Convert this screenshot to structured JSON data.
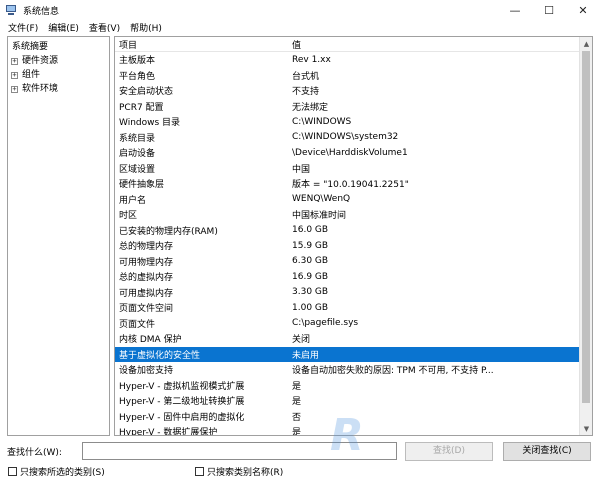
{
  "window": {
    "title": "系统信息",
    "controls": {
      "minimize": "—",
      "maximize": "☐",
      "close": "✕"
    }
  },
  "menu": [
    "文件(F)",
    "编辑(E)",
    "查看(V)",
    "帮助(H)"
  ],
  "tree": {
    "root": "系统摘要",
    "children": [
      "硬件资源",
      "组件",
      "软件环境"
    ],
    "expander": "+"
  },
  "table": {
    "headers": {
      "item": "项目",
      "value": "值"
    },
    "rows": [
      {
        "item": "主板版本",
        "value": "Rev 1.xx"
      },
      {
        "item": "平台角色",
        "value": "台式机"
      },
      {
        "item": "安全启动状态",
        "value": "不支持"
      },
      {
        "item": "PCR7 配置",
        "value": "无法绑定"
      },
      {
        "item": "Windows 目录",
        "value": "C:\\WINDOWS"
      },
      {
        "item": "系统目录",
        "value": "C:\\WINDOWS\\system32"
      },
      {
        "item": "启动设备",
        "value": "\\Device\\HarddiskVolume1"
      },
      {
        "item": "区域设置",
        "value": "中国"
      },
      {
        "item": "硬件抽象层",
        "value": "版本 = \"10.0.19041.2251\""
      },
      {
        "item": "用户名",
        "value": "WENQ\\WenQ"
      },
      {
        "item": "时区",
        "value": "中国标准时间"
      },
      {
        "item": "已安装的物理内存(RAM)",
        "value": "16.0 GB"
      },
      {
        "item": "总的物理内存",
        "value": "15.9 GB"
      },
      {
        "item": "可用物理内存",
        "value": "6.30 GB"
      },
      {
        "item": "总的虚拟内存",
        "value": "16.9 GB"
      },
      {
        "item": "可用虚拟内存",
        "value": "3.30 GB"
      },
      {
        "item": "页面文件空间",
        "value": "1.00 GB"
      },
      {
        "item": "页面文件",
        "value": "C:\\pagefile.sys"
      },
      {
        "item": "内核 DMA 保护",
        "value": "关闭"
      },
      {
        "item": "基于虚拟化的安全性",
        "value": "未启用"
      },
      {
        "item": "设备加密支持",
        "value": "设备自动加密失败的原因: TPM 不可用, 不支持 P..."
      },
      {
        "item": "Hyper-V - 虚拟机监视模式扩展",
        "value": "是"
      },
      {
        "item": "Hyper-V - 第二级地址转换扩展",
        "value": "是"
      },
      {
        "item": "Hyper-V - 固件中启用的虚拟化",
        "value": "否"
      },
      {
        "item": "Hyper-V - 数据扩展保护",
        "value": "是"
      }
    ],
    "selected_row": "基于虚拟化的安全性"
  },
  "find": {
    "label": "查找什么(W):",
    "input_value": "",
    "find_button": "查找(D)",
    "close_button": "关闭查找(C)"
  },
  "options": {
    "search_selected_category": "只搜索所选的类别(S)",
    "search_category_names": "只搜索类别名称(R)"
  },
  "watermark": "R"
}
